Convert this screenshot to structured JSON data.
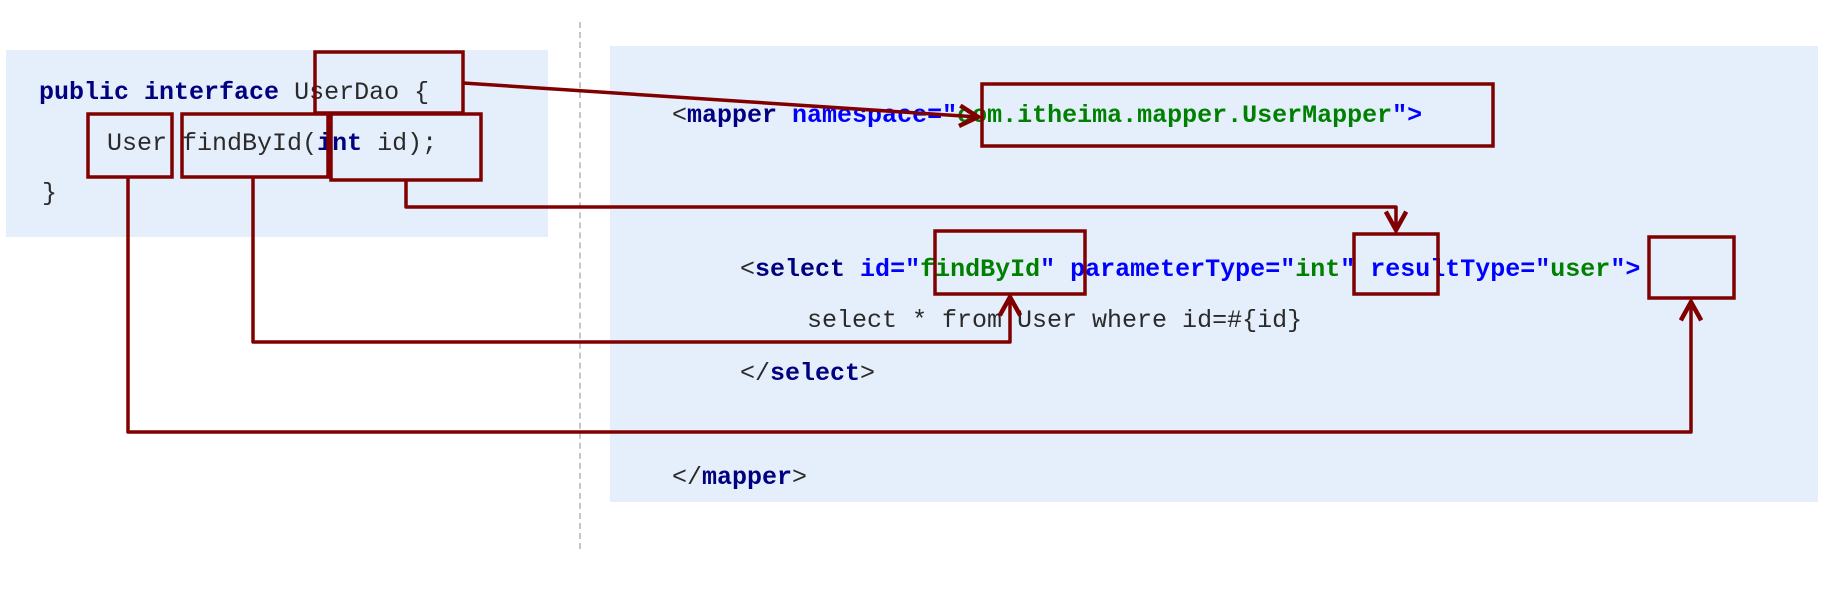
{
  "java": {
    "line1": {
      "kw1": "public",
      "kw2": "interface",
      "name": "UserDao",
      "brace": " {"
    },
    "line2": {
      "ret": "User",
      "method": "findById",
      "paren": "(",
      "kw": "int",
      "param": " id);"
    },
    "line3": {
      "close": "}"
    }
  },
  "xml": {
    "mapper_open": {
      "lt": "<",
      "tag": "mapper",
      "attr": "namespace",
      "eq": "=\"",
      "value": "com.itheima.mapper.UserMapper",
      "end": "\">"
    },
    "select_open": {
      "lt": "<",
      "tag": "select",
      "id_attr": "id",
      "id_q": "=\"",
      "id_value": "findById",
      "id_end": "\"",
      "pt_attr": "parameterType",
      "pt_q": "=\"",
      "pt_value": "int",
      "pt_end": "\"",
      "rt_attr": "resultType",
      "rt_q": "=\"",
      "rt_value": "user",
      "rt_end": "\">"
    },
    "sql": "select * from User where id=#{id}",
    "select_close": {
      "lt": "</",
      "tag": "select",
      "gt": ">"
    },
    "mapper_close": {
      "lt": "</",
      "tag": "mapper",
      "gt": ">"
    }
  },
  "colors": {
    "highlight": "#800000",
    "panel": "#e5eefb",
    "keyword": "#000080",
    "attribute": "#0000ff",
    "string": "#008000"
  }
}
